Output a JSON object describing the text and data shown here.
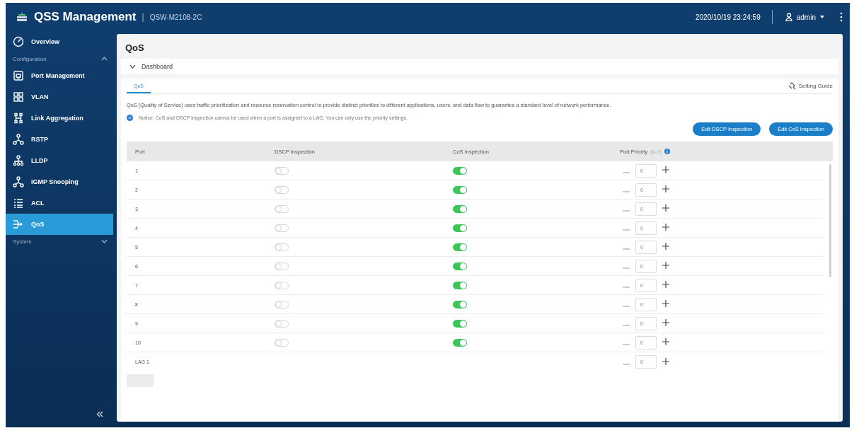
{
  "header": {
    "app_title": "QSS Management",
    "separator": "|",
    "model": "QSW-M2108-2C",
    "datetime": "2020/10/19 23:24:59",
    "user": "admin"
  },
  "sidebar": {
    "items": [
      {
        "kind": "item",
        "label": "Overview",
        "selected": false
      },
      {
        "kind": "section",
        "label": "Configuration",
        "expanded": true
      },
      {
        "kind": "item",
        "label": "Port Management",
        "selected": false
      },
      {
        "kind": "item",
        "label": "VLAN",
        "selected": false
      },
      {
        "kind": "item",
        "label": "Link Aggregation",
        "selected": false
      },
      {
        "kind": "item",
        "label": "RSTP",
        "selected": false
      },
      {
        "kind": "item",
        "label": "LLDP",
        "selected": false
      },
      {
        "kind": "item",
        "label": "IGMP Snooping",
        "selected": false
      },
      {
        "kind": "item",
        "label": "ACL",
        "selected": false
      },
      {
        "kind": "item",
        "label": "QoS",
        "selected": true
      },
      {
        "kind": "section",
        "label": "System",
        "expanded": false
      }
    ]
  },
  "page": {
    "title": "QoS",
    "dashboard": {
      "label": "Dashboard",
      "expanded": false
    },
    "tabs": [
      {
        "label": "QoS",
        "selected": true
      }
    ],
    "setting_guide": "Setting Guide",
    "description": "QoS (Quality of Service) uses traffic prioritization and resource reservation control to provide distinct priorities to different applications, users, and data flow to guarantee a standard level of network performance.",
    "notice": "Notice: CoS and DSCP inspection cannot be used when a port is assigned to a LAG. You can only use the priority settings.",
    "buttons": [
      "Edit DSCP Inspection",
      "Edit CoS Inspection"
    ],
    "table": {
      "columns": [
        "Port",
        "DSCP Inspection",
        "CoS Inspection",
        "Port Priority"
      ],
      "priority_range": "(0-7)",
      "rows": [
        {
          "kind": "port",
          "port": "1",
          "dscp": false,
          "cos": true,
          "priority": "0"
        },
        {
          "kind": "port",
          "port": "2",
          "dscp": false,
          "cos": true,
          "priority": "0"
        },
        {
          "kind": "port",
          "port": "3",
          "dscp": false,
          "cos": true,
          "priority": "0"
        },
        {
          "kind": "port",
          "port": "4",
          "dscp": false,
          "cos": true,
          "priority": "0"
        },
        {
          "kind": "port",
          "port": "5",
          "dscp": false,
          "cos": true,
          "priority": "0"
        },
        {
          "kind": "port",
          "port": "6",
          "dscp": false,
          "cos": true,
          "priority": "0"
        },
        {
          "kind": "port",
          "port": "7",
          "dscp": false,
          "cos": true,
          "priority": "0"
        },
        {
          "kind": "port",
          "port": "8",
          "dscp": false,
          "cos": true,
          "priority": "0"
        },
        {
          "kind": "port",
          "port": "9",
          "dscp": false,
          "cos": true,
          "priority": "0"
        },
        {
          "kind": "port",
          "port": "10",
          "dscp": false,
          "cos": true,
          "priority": "0"
        },
        {
          "kind": "lag",
          "port": "LAG 1",
          "priority": "0"
        }
      ]
    },
    "apply": {
      "disabled": true
    }
  }
}
